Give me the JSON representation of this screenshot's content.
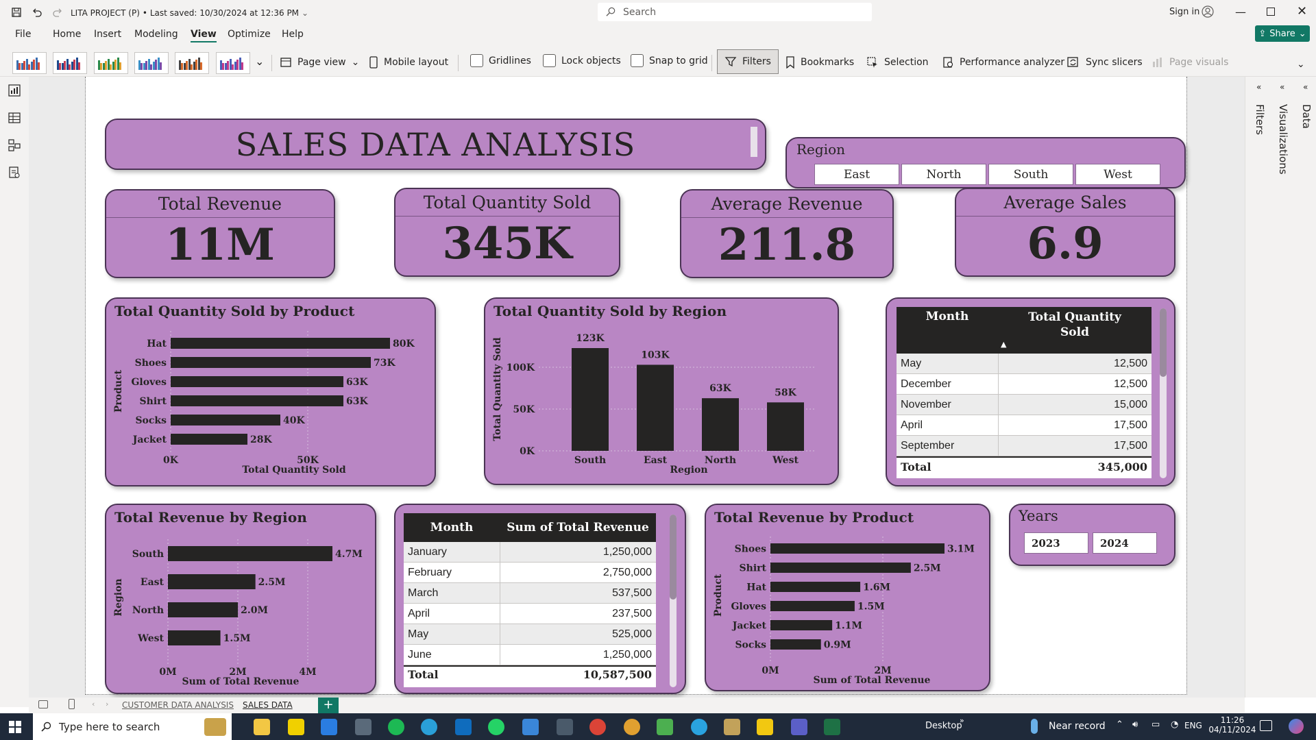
{
  "titlebar": {
    "doc_title": "LITA PROJECT (P)",
    "saved": "• Last saved: 10/30/2024 at 12:36 PM",
    "search_placeholder": "Search",
    "sign_in": "Sign in"
  },
  "menu": {
    "items": [
      "File",
      "Home",
      "Insert",
      "Modeling",
      "View",
      "Optimize",
      "Help"
    ],
    "active": "View",
    "share": "Share"
  },
  "ribbon": {
    "page_view": "Page view",
    "mobile_layout": "Mobile layout",
    "gridlines": "Gridlines",
    "lock_objects": "Lock objects",
    "snap_to_grid": "Snap to grid",
    "filters": "Filters",
    "bookmarks": "Bookmarks",
    "selection": "Selection",
    "performance_analyzer": "Performance analyzer",
    "sync_slicers": "Sync slicers",
    "page_visuals": "Page visuals"
  },
  "panes": {
    "filters": "Filters",
    "visualizations": "Visualizations",
    "data": "Data"
  },
  "report": {
    "title": "SALES DATA ANALYSIS",
    "region_slicer": {
      "label": "Region",
      "options": [
        "East",
        "North",
        "South",
        "West"
      ]
    },
    "years_slicer": {
      "label": "Years",
      "options": [
        "2023",
        "2024"
      ]
    },
    "kpis": [
      {
        "label": "Total Revenue",
        "value": "11M"
      },
      {
        "label": "Total Quantity Sold",
        "value": "345K"
      },
      {
        "label": "Average Revenue",
        "value": "211.8"
      },
      {
        "label": "Average Sales",
        "value": "6.9"
      }
    ],
    "month_qty_table": {
      "headers": [
        "Month",
        "Total Quantity Sold"
      ],
      "rows": [
        [
          "May",
          "12,500"
        ],
        [
          "December",
          "12,500"
        ],
        [
          "November",
          "15,000"
        ],
        [
          "April",
          "17,500"
        ],
        [
          "September",
          "17,500"
        ]
      ],
      "total": [
        "Total",
        "345,000"
      ]
    },
    "month_revenue_table": {
      "headers": [
        "Month",
        "Sum of Total Revenue"
      ],
      "rows": [
        [
          "January",
          "1,250,000"
        ],
        [
          "February",
          "2,750,000"
        ],
        [
          "March",
          "537,500"
        ],
        [
          "April",
          "237,500"
        ],
        [
          "May",
          "525,000"
        ],
        [
          "June",
          "1,250,000"
        ]
      ],
      "total": [
        "Total",
        "10,587,500"
      ]
    }
  },
  "chart_data": [
    {
      "type": "bar",
      "orientation": "horizontal",
      "title": "Total Quantity Sold by Product",
      "xlabel": "Total Quantity Sold",
      "ylabel": "Product",
      "categories": [
        "Hat",
        "Shoes",
        "Gloves",
        "Shirt",
        "Socks",
        "Jacket"
      ],
      "values": [
        80000,
        73000,
        63000,
        63000,
        40000,
        28000
      ],
      "labels": [
        "80K",
        "73K",
        "63K",
        "63K",
        "40K",
        "28K"
      ],
      "xticks": [
        "0K",
        "50K"
      ],
      "xlim": [
        0,
        100000
      ],
      "color": "#252423"
    },
    {
      "type": "bar",
      "orientation": "vertical",
      "title": "Total Quantity Sold by Region",
      "xlabel": "Region",
      "ylabel": "Total Quantity Sold",
      "categories": [
        "South",
        "East",
        "North",
        "West"
      ],
      "values": [
        123000,
        103000,
        63000,
        58000
      ],
      "labels": [
        "123K",
        "103K",
        "63K",
        "58K"
      ],
      "yticks": [
        "0K",
        "50K",
        "100K"
      ],
      "ylim": [
        0,
        123000
      ],
      "color": "#252423"
    },
    {
      "type": "bar",
      "orientation": "horizontal",
      "title": "Total Revenue by Region",
      "xlabel": "Sum of Total Revenue",
      "ylabel": "Region",
      "categories": [
        "South",
        "East",
        "North",
        "West"
      ],
      "values": [
        4700000,
        2500000,
        2000000,
        1500000
      ],
      "labels": [
        "4.7M",
        "2.5M",
        "2.0M",
        "1.5M"
      ],
      "xticks": [
        "0M",
        "2M",
        "4M"
      ],
      "xlim": [
        0,
        4700000
      ],
      "color": "#252423"
    },
    {
      "type": "bar",
      "orientation": "horizontal",
      "title": "Total Revenue by Product",
      "xlabel": "Sum of Total Revenue",
      "ylabel": "Product",
      "categories": [
        "Shoes",
        "Shirt",
        "Hat",
        "Gloves",
        "Jacket",
        "Socks"
      ],
      "values": [
        3100000,
        2500000,
        1600000,
        1500000,
        1100000,
        900000
      ],
      "labels": [
        "3.1M",
        "2.5M",
        "1.6M",
        "1.5M",
        "1.1M",
        "0.9M"
      ],
      "xticks": [
        "0M",
        "2M"
      ],
      "xlim": [
        0,
        3100000
      ],
      "color": "#252423"
    }
  ],
  "page_tabs": [
    "CUSTOMER DATA ANALYSIS",
    "SALES DATA"
  ],
  "taskbar": {
    "search_placeholder": "Type here to search",
    "desktop": "Desktop",
    "weather": "Near record",
    "lang": "ENG",
    "time": "11:26",
    "date": "04/11/2024"
  }
}
